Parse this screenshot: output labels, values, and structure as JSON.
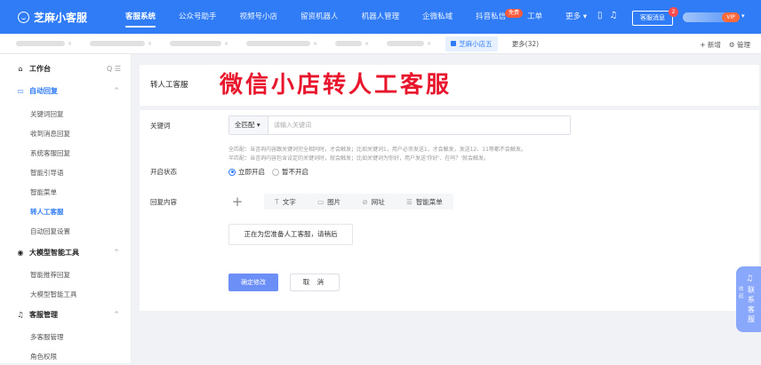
{
  "app": {
    "name": "芝麻小客服"
  },
  "top_nav": [
    {
      "label": "客服系统",
      "active": true
    },
    {
      "label": "公众号助手"
    },
    {
      "label": "视频号小店"
    },
    {
      "label": "留资机器人"
    },
    {
      "label": "机器人管理"
    },
    {
      "label": "企微私域"
    },
    {
      "label": "抖音私信"
    },
    {
      "label": "工单"
    },
    {
      "label": "更多 ▾"
    }
  ],
  "badges": {
    "free": "免费",
    "message_count": "2"
  },
  "header": {
    "message_button": "客服消息",
    "user_tag": "VIP",
    "phone_icon": "▯",
    "bell_icon": "♫",
    "caret": "▾"
  },
  "tabs": {
    "active_label": "芝麻小店五",
    "more_label": "更多(32)",
    "add_label": "+ 新增",
    "manage_label": "⚙ 管理",
    "close": "×"
  },
  "sidebar": {
    "workbench": "工作台",
    "auto_reply": "自动回复",
    "auto_reply_items": [
      "关键词回复",
      "收到消息回复",
      "系统客服回复",
      "智能引导语",
      "智能菜单",
      "转人工客服",
      "自动回复设置"
    ],
    "ai_tools": "大模型智能工具",
    "ai_tools_items": [
      "智能推荐回复",
      "大模型智能工具"
    ],
    "service": "客服管理",
    "service_items": [
      "多客服管理",
      "角色权限"
    ],
    "tool_icons": "Q  ☰",
    "caret": "^"
  },
  "page": {
    "title": "转人工客服",
    "overlay_text": "微信小店转人工客服"
  },
  "form": {
    "keyword_label": "关键词",
    "match_select": "全匹配 ▾",
    "keyword_placeholder": "请输入关键词",
    "hint1": "全匹配：当咨询内容跟关键词完全相同时，才会触发；比如关键词1，用户必须发送1，才会触发，发送12、11等都不会触发。",
    "hint2": "半匹配：当咨询内容包含设定的关键词时，就会触发；比如关键词为你好，用户发送'你好'、在吗？'就会触发。",
    "status_label": "开启状态",
    "status_on": "立即开启",
    "status_off": "暂不开启",
    "reply_label": "回复内容",
    "reply_tools": [
      {
        "icon": "T",
        "label": "文字"
      },
      {
        "icon": "▭",
        "label": "图片"
      },
      {
        "icon": "⊘",
        "label": "网址"
      },
      {
        "icon": "☰",
        "label": "智能菜单"
      }
    ],
    "reply_message": "正在为您准备人工客服，请稍后",
    "confirm": "确定修改",
    "cancel": "取 消"
  },
  "float_panel": {
    "icon": "♫",
    "small": "收起",
    "label": "联系客服"
  }
}
